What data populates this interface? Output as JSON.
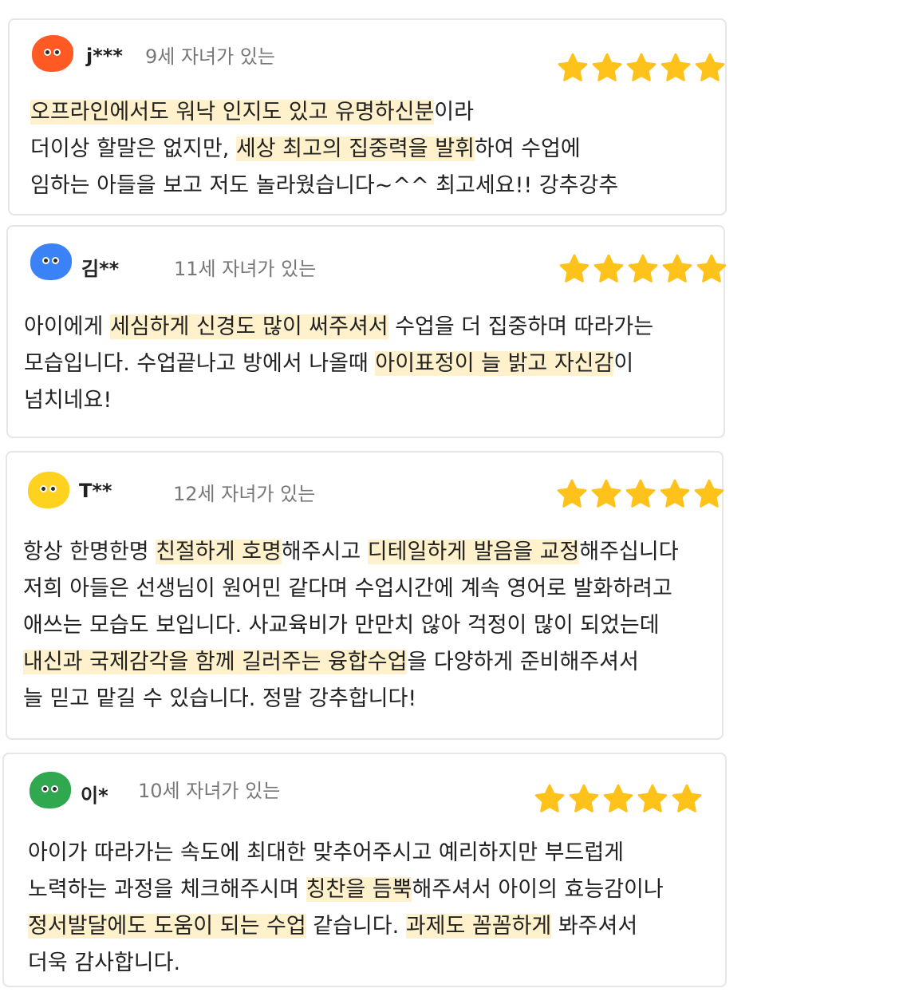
{
  "colors": {
    "star": "#ffc21a",
    "highlight": "#fff1cc",
    "card_border": "#e6e6e6"
  },
  "reviews": [
    {
      "name": "j***",
      "subtitle": "9세 자녀가 있는",
      "avatar_color": "#ff5a24",
      "rating": 5,
      "lines": [
        [
          {
            "text": "오프라인에서도 워낙 인지도 있고 유명하신분",
            "hl": true
          },
          {
            "text": "이라",
            "hl": false
          }
        ],
        [
          {
            "text": "더이상 할말은 없지만, ",
            "hl": false
          },
          {
            "text": "세상 최고의 집중력을 발휘",
            "hl": true
          },
          {
            "text": "하여 수업에",
            "hl": false
          }
        ],
        [
          {
            "text": "임하는 아들을 보고 저도 놀라웠습니다~^^ 최고세요!! 강추강추",
            "hl": false
          }
        ]
      ]
    },
    {
      "name": "김**",
      "subtitle": "11세 자녀가 있는",
      "avatar_color": "#3b82f6",
      "rating": 5,
      "lines": [
        [
          {
            "text": "아이에게 ",
            "hl": false
          },
          {
            "text": "세심하게 신경도 많이 써주셔서",
            "hl": true
          },
          {
            "text": " 수업을 더 집중하며 따라가는",
            "hl": false
          }
        ],
        [
          {
            "text": "모습입니다. 수업끝나고 방에서 나올때 ",
            "hl": false
          },
          {
            "text": "아이표정이 늘 밝고 자신감",
            "hl": true
          },
          {
            "text": "이",
            "hl": false
          }
        ],
        [
          {
            "text": "넘치네요!",
            "hl": false
          }
        ]
      ]
    },
    {
      "name": "T**",
      "subtitle": "12세 자녀가 있는",
      "avatar_color": "#ffd21f",
      "rating": 5,
      "lines": [
        [
          {
            "text": "항상 한명한명 ",
            "hl": false
          },
          {
            "text": "친절하게 호명",
            "hl": true
          },
          {
            "text": "해주시고 ",
            "hl": false
          },
          {
            "text": "디테일하게 발음을 교정",
            "hl": true
          },
          {
            "text": "해주십니다",
            "hl": false
          }
        ],
        [
          {
            "text": "저희 아들은 선생님이 원어민 같다며 수업시간에 계속 영어로 발화하려고",
            "hl": false
          }
        ],
        [
          {
            "text": "애쓰는 모습도 보입니다. 사교육비가 만만치 않아 걱정이 많이 되었는데",
            "hl": false
          }
        ],
        [
          {
            "text": "내신과 국제감각을 함께 길러주는 융합수업",
            "hl": true
          },
          {
            "text": "을 다양하게 준비해주셔서",
            "hl": false
          }
        ],
        [
          {
            "text": "늘 믿고 맡길 수 있습니다. 정말 강추합니다!",
            "hl": false
          }
        ]
      ]
    },
    {
      "name": "이*",
      "subtitle": "10세 자녀가 있는",
      "avatar_color": "#2fa84f",
      "rating": 5,
      "lines": [
        [
          {
            "text": "아이가 따라가는 속도에 최대한 맞추어주시고 예리하지만 부드럽게",
            "hl": false
          }
        ],
        [
          {
            "text": "노력하는 과정을 체크해주시며 ",
            "hl": false
          },
          {
            "text": "칭찬을 듬뿍",
            "hl": true
          },
          {
            "text": "해주셔서 아이의 효능감이나",
            "hl": false
          }
        ],
        [
          {
            "text": "정서발달에도 도움이 되는 수업",
            "hl": true
          },
          {
            "text": " 같습니다. ",
            "hl": false
          },
          {
            "text": "과제도 꼼꼼하게",
            "hl": true
          },
          {
            "text": " 봐주셔서",
            "hl": false
          }
        ],
        [
          {
            "text": "더욱 감사합니다.",
            "hl": false
          }
        ]
      ]
    }
  ]
}
